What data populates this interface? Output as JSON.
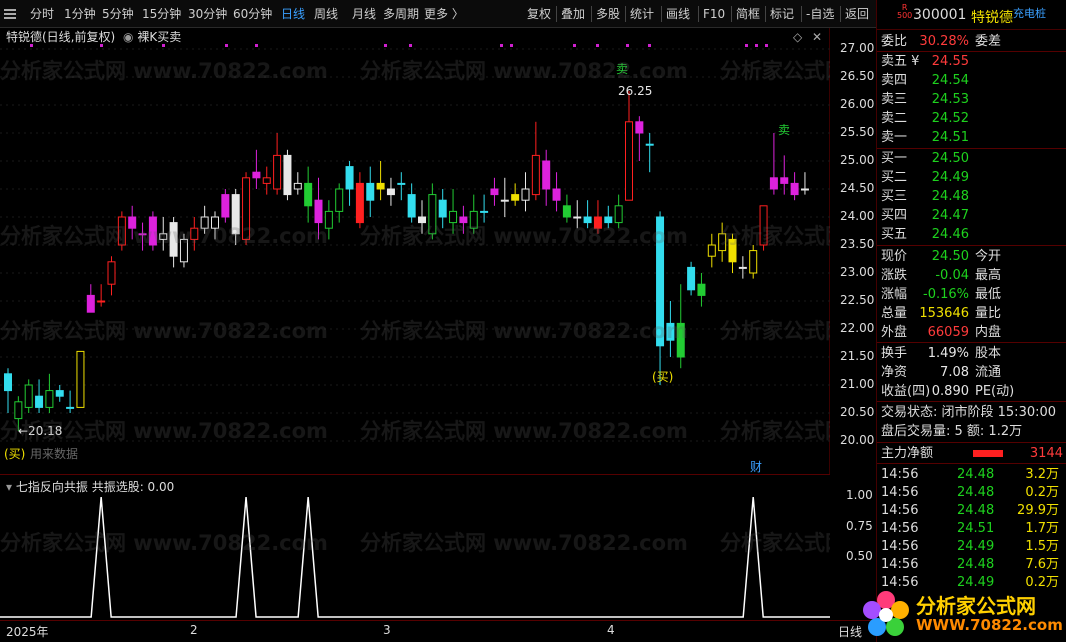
{
  "toolbar": {
    "items": [
      "分时",
      "1分钟",
      "5分钟",
      "15分钟",
      "30分钟",
      "60分钟",
      "日线",
      "周线",
      "月线",
      "多周期",
      "更多 〉"
    ],
    "active_index": 6,
    "right_items": [
      "复权",
      "叠加",
      "多股",
      "统计",
      "画线",
      "F10",
      "简框",
      "标记",
      "-自选",
      "返回"
    ]
  },
  "main_chart": {
    "title": "特锐德(日线,前复权)",
    "indicator": "裸K买卖",
    "annotations": {
      "high_label": "26.25",
      "low_label": "←20.18",
      "sell_1": "卖",
      "sell_2": "卖",
      "buy_1": "买",
      "buy_2": "买",
      "buy_text": "用来数据",
      "finance_tag": "财"
    },
    "price_ticks": [
      "27.00",
      "26.50",
      "26.00",
      "25.50",
      "25.00",
      "24.50",
      "24.00",
      "23.50",
      "23.00",
      "22.50",
      "22.00",
      "21.50",
      "21.00",
      "20.50",
      "20.00"
    ]
  },
  "sub_chart": {
    "title": "七指反向共振",
    "value_label": "共振选股: 0.00",
    "ticks": [
      "1.00",
      "0.75",
      "0.50"
    ]
  },
  "date_axis": {
    "labels": [
      "2025年",
      "2",
      "3",
      "4"
    ],
    "right_label": "日线"
  },
  "chart_data": {
    "type": "candlestick",
    "title": "特锐德(日线,前复权)",
    "ylim": [
      20.0,
      27.0
    ],
    "candles": [
      {
        "o": 20.9,
        "c": 21.2,
        "h": 21.3,
        "l": 20.5,
        "color": "cyan"
      },
      {
        "o": 20.4,
        "c": 20.7,
        "h": 20.8,
        "l": 20.18,
        "color": "green"
      },
      {
        "o": 20.6,
        "c": 21.0,
        "h": 21.1,
        "l": 20.5,
        "color": "green"
      },
      {
        "o": 20.8,
        "c": 20.6,
        "h": 21.1,
        "l": 20.5,
        "color": "cyan"
      },
      {
        "o": 20.6,
        "c": 20.9,
        "h": 21.2,
        "l": 20.5,
        "color": "green"
      },
      {
        "o": 20.9,
        "c": 20.8,
        "h": 21.0,
        "l": 20.7,
        "color": "cyan"
      },
      {
        "o": 20.6,
        "c": 20.6,
        "h": 20.9,
        "l": 20.5,
        "color": "cyan"
      },
      {
        "o": 20.6,
        "c": 21.6,
        "h": 21.6,
        "l": 20.6,
        "color": "yellow"
      },
      {
        "o": 22.3,
        "c": 22.6,
        "h": 22.8,
        "l": 22.3,
        "color": "magenta"
      },
      {
        "o": 22.5,
        "c": 22.5,
        "h": 22.8,
        "l": 22.4,
        "color": "red"
      },
      {
        "o": 22.8,
        "c": 23.2,
        "h": 23.3,
        "l": 22.6,
        "color": "red"
      },
      {
        "o": 23.5,
        "c": 24.0,
        "h": 24.1,
        "l": 23.4,
        "color": "red"
      },
      {
        "o": 24.0,
        "c": 23.8,
        "h": 24.2,
        "l": 23.6,
        "color": "magenta"
      },
      {
        "o": 23.7,
        "c": 23.7,
        "h": 23.9,
        "l": 23.4,
        "color": "magenta"
      },
      {
        "o": 23.5,
        "c": 24.0,
        "h": 24.1,
        "l": 23.4,
        "color": "magenta"
      },
      {
        "o": 23.6,
        "c": 23.7,
        "h": 24.0,
        "l": 23.4,
        "color": "white"
      },
      {
        "o": 23.9,
        "c": 23.3,
        "h": 24.0,
        "l": 23.1,
        "color": "white"
      },
      {
        "o": 23.2,
        "c": 23.6,
        "h": 23.7,
        "l": 23.1,
        "color": "white"
      },
      {
        "o": 23.6,
        "c": 23.8,
        "h": 24.0,
        "l": 23.4,
        "color": "red"
      },
      {
        "o": 23.8,
        "c": 24.0,
        "h": 24.2,
        "l": 23.7,
        "color": "white"
      },
      {
        "o": 23.8,
        "c": 24.0,
        "h": 24.1,
        "l": 23.6,
        "color": "white"
      },
      {
        "o": 24.0,
        "c": 24.4,
        "h": 24.5,
        "l": 23.9,
        "color": "magenta"
      },
      {
        "o": 24.4,
        "c": 23.7,
        "h": 24.5,
        "l": 23.5,
        "color": "white"
      },
      {
        "o": 23.6,
        "c": 24.7,
        "h": 24.8,
        "l": 23.5,
        "color": "red"
      },
      {
        "o": 24.7,
        "c": 24.8,
        "h": 25.2,
        "l": 24.5,
        "color": "magenta"
      },
      {
        "o": 24.6,
        "c": 24.7,
        "h": 24.9,
        "l": 24.4,
        "color": "red"
      },
      {
        "o": 24.5,
        "c": 25.1,
        "h": 25.5,
        "l": 24.4,
        "color": "red"
      },
      {
        "o": 25.1,
        "c": 24.4,
        "h": 25.2,
        "l": 24.3,
        "color": "white"
      },
      {
        "o": 24.5,
        "c": 24.6,
        "h": 24.8,
        "l": 24.4,
        "color": "white"
      },
      {
        "o": 24.6,
        "c": 24.2,
        "h": 24.9,
        "l": 23.9,
        "color": "green"
      },
      {
        "o": 24.3,
        "c": 23.9,
        "h": 24.7,
        "l": 23.6,
        "color": "magenta"
      },
      {
        "o": 23.8,
        "c": 24.1,
        "h": 24.3,
        "l": 23.6,
        "color": "green"
      },
      {
        "o": 24.1,
        "c": 24.5,
        "h": 24.6,
        "l": 23.9,
        "color": "green"
      },
      {
        "o": 24.5,
        "c": 24.9,
        "h": 25.0,
        "l": 24.2,
        "color": "cyan"
      },
      {
        "o": 24.6,
        "c": 23.9,
        "h": 24.8,
        "l": 23.8,
        "color": "red"
      },
      {
        "o": 24.3,
        "c": 24.6,
        "h": 24.9,
        "l": 24.0,
        "color": "cyan"
      },
      {
        "o": 24.6,
        "c": 24.5,
        "h": 25.0,
        "l": 24.3,
        "color": "yellow"
      },
      {
        "o": 24.5,
        "c": 24.4,
        "h": 24.7,
        "l": 24.2,
        "color": "white"
      },
      {
        "o": 24.6,
        "c": 24.6,
        "h": 24.8,
        "l": 24.3,
        "color": "cyan"
      },
      {
        "o": 24.4,
        "c": 24.0,
        "h": 24.6,
        "l": 23.9,
        "color": "cyan"
      },
      {
        "o": 24.0,
        "c": 23.9,
        "h": 24.3,
        "l": 23.7,
        "color": "white"
      },
      {
        "o": 23.7,
        "c": 24.4,
        "h": 24.6,
        "l": 23.6,
        "color": "green"
      },
      {
        "o": 24.3,
        "c": 24.0,
        "h": 24.5,
        "l": 23.8,
        "color": "cyan"
      },
      {
        "o": 23.9,
        "c": 24.1,
        "h": 24.5,
        "l": 23.7,
        "color": "green"
      },
      {
        "o": 24.0,
        "c": 23.9,
        "h": 24.2,
        "l": 23.7,
        "color": "magenta"
      },
      {
        "o": 23.8,
        "c": 24.1,
        "h": 24.4,
        "l": 23.7,
        "color": "green"
      },
      {
        "o": 24.1,
        "c": 24.1,
        "h": 24.4,
        "l": 23.9,
        "color": "cyan"
      },
      {
        "o": 24.4,
        "c": 24.5,
        "h": 24.7,
        "l": 24.2,
        "color": "magenta"
      },
      {
        "o": 24.3,
        "c": 24.3,
        "h": 24.7,
        "l": 24.0,
        "color": "white"
      },
      {
        "o": 24.4,
        "c": 24.3,
        "h": 24.6,
        "l": 24.2,
        "color": "yellow"
      },
      {
        "o": 24.3,
        "c": 24.5,
        "h": 24.8,
        "l": 24.1,
        "color": "white"
      },
      {
        "o": 24.4,
        "c": 25.1,
        "h": 25.7,
        "l": 24.3,
        "color": "red"
      },
      {
        "o": 25.0,
        "c": 24.5,
        "h": 25.2,
        "l": 24.2,
        "color": "magenta"
      },
      {
        "o": 24.5,
        "c": 24.3,
        "h": 24.8,
        "l": 24.1,
        "color": "magenta"
      },
      {
        "o": 24.2,
        "c": 24.0,
        "h": 24.4,
        "l": 23.9,
        "color": "green"
      },
      {
        "o": 24.0,
        "c": 24.0,
        "h": 24.3,
        "l": 23.8,
        "color": "white"
      },
      {
        "o": 23.9,
        "c": 24.0,
        "h": 24.3,
        "l": 23.8,
        "color": "cyan"
      },
      {
        "o": 24.0,
        "c": 23.8,
        "h": 24.3,
        "l": 23.7,
        "color": "red"
      },
      {
        "o": 24.0,
        "c": 23.9,
        "h": 24.2,
        "l": 23.8,
        "color": "cyan"
      },
      {
        "o": 23.9,
        "c": 24.2,
        "h": 24.4,
        "l": 23.8,
        "color": "green"
      },
      {
        "o": 24.3,
        "c": 25.7,
        "h": 26.25,
        "l": 24.3,
        "color": "red"
      },
      {
        "o": 25.7,
        "c": 25.5,
        "h": 25.8,
        "l": 25.0,
        "color": "magenta"
      },
      {
        "o": 25.3,
        "c": 25.3,
        "h": 25.5,
        "l": 24.8,
        "color": "cyan"
      },
      {
        "o": 24.0,
        "c": 21.7,
        "h": 24.1,
        "l": 21.0,
        "color": "cyan"
      },
      {
        "o": 21.8,
        "c": 22.1,
        "h": 22.5,
        "l": 21.5,
        "color": "cyan"
      },
      {
        "o": 22.1,
        "c": 21.5,
        "h": 22.8,
        "l": 21.3,
        "color": "green"
      },
      {
        "o": 22.7,
        "c": 23.1,
        "h": 23.2,
        "l": 22.6,
        "color": "cyan"
      },
      {
        "o": 22.8,
        "c": 22.6,
        "h": 23.0,
        "l": 22.4,
        "color": "green"
      },
      {
        "o": 23.3,
        "c": 23.5,
        "h": 23.7,
        "l": 23.1,
        "color": "yellow"
      },
      {
        "o": 23.4,
        "c": 23.7,
        "h": 23.9,
        "l": 23.2,
        "color": "yellow"
      },
      {
        "o": 23.6,
        "c": 23.2,
        "h": 23.7,
        "l": 23.0,
        "color": "yellow"
      },
      {
        "o": 23.1,
        "c": 23.1,
        "h": 23.3,
        "l": 22.9,
        "color": "white"
      },
      {
        "o": 23.0,
        "c": 23.4,
        "h": 23.5,
        "l": 22.9,
        "color": "yellow"
      },
      {
        "o": 23.5,
        "c": 24.2,
        "h": 24.2,
        "l": 23.4,
        "color": "red"
      },
      {
        "o": 24.5,
        "c": 24.7,
        "h": 25.5,
        "l": 24.4,
        "color": "magenta"
      },
      {
        "o": 24.6,
        "c": 24.7,
        "h": 25.1,
        "l": 24.4,
        "color": "magenta"
      },
      {
        "o": 24.6,
        "c": 24.4,
        "h": 24.8,
        "l": 24.3,
        "color": "magenta"
      },
      {
        "o": 24.5,
        "c": 24.5,
        "h": 24.8,
        "l": 24.4,
        "color": "white"
      }
    ],
    "signal_series": {
      "name": "共振选股",
      "spikes": [
        9,
        23,
        29,
        72
      ],
      "ylim": [
        0,
        1
      ]
    }
  },
  "quote": {
    "stock_code": "300001",
    "stock_name": "特锐德",
    "tag": "充电桩",
    "badge_top": "R",
    "badge_bottom": "500",
    "wei_bi_label": "委比",
    "wei_bi_value": "30.28%",
    "wei_cha_label": "委差",
    "asks": [
      {
        "label": "卖五 ¥",
        "price": "24.55"
      },
      {
        "label": "卖四",
        "price": "24.54"
      },
      {
        "label": "卖三",
        "price": "24.53"
      },
      {
        "label": "卖二",
        "price": "24.52"
      },
      {
        "label": "卖一",
        "price": "24.51"
      }
    ],
    "bids": [
      {
        "label": "买一",
        "price": "24.50"
      },
      {
        "label": "买二",
        "price": "24.49"
      },
      {
        "label": "买三",
        "price": "24.48"
      },
      {
        "label": "买四",
        "price": "24.47"
      },
      {
        "label": "买五",
        "price": "24.46"
      }
    ],
    "stats": [
      {
        "l": "现价",
        "v": "24.50",
        "vc": "green",
        "l2": "今开"
      },
      {
        "l": "涨跌",
        "v": "-0.04",
        "vc": "green",
        "l2": "最高"
      },
      {
        "l": "涨幅",
        "v": "-0.16%",
        "vc": "green",
        "l2": "最低"
      },
      {
        "l": "总量",
        "v": "153646",
        "vc": "yellow",
        "l2": "量比"
      },
      {
        "l": "外盘",
        "v": "66059",
        "vc": "red",
        "l2": "内盘"
      }
    ],
    "stats2": [
      {
        "l": "换手",
        "v": "1.49%",
        "l2": "股本"
      },
      {
        "l": "净资",
        "v": "7.08",
        "l2": "流通"
      },
      {
        "l": "收益(四)",
        "v": "0.890",
        "l2": "PE(动)"
      }
    ],
    "trade_state": "交易状态: 闭市阶段 15:30:00",
    "after_hours": "盘后交易量: 5  额: 1.2万",
    "main_flow_label": "主力净额",
    "main_flow_value": "3144",
    "ticks": [
      {
        "t": "14:56",
        "p": "24.48",
        "q": "3.2万"
      },
      {
        "t": "14:56",
        "p": "24.48",
        "q": "0.2万"
      },
      {
        "t": "14:56",
        "p": "24.48",
        "q": "29.9万"
      },
      {
        "t": "14:56",
        "p": "24.51",
        "q": "1.7万"
      },
      {
        "t": "14:56",
        "p": "24.49",
        "q": "1.5万"
      },
      {
        "t": "14:56",
        "p": "24.48",
        "q": "7.6万"
      },
      {
        "t": "14:56",
        "p": "24.49",
        "q": "0.2万"
      }
    ]
  },
  "watermark": "分析家公式网 www.70822.com",
  "logo": {
    "name": "分析家公式网",
    "url": "WWW.70822.com"
  }
}
